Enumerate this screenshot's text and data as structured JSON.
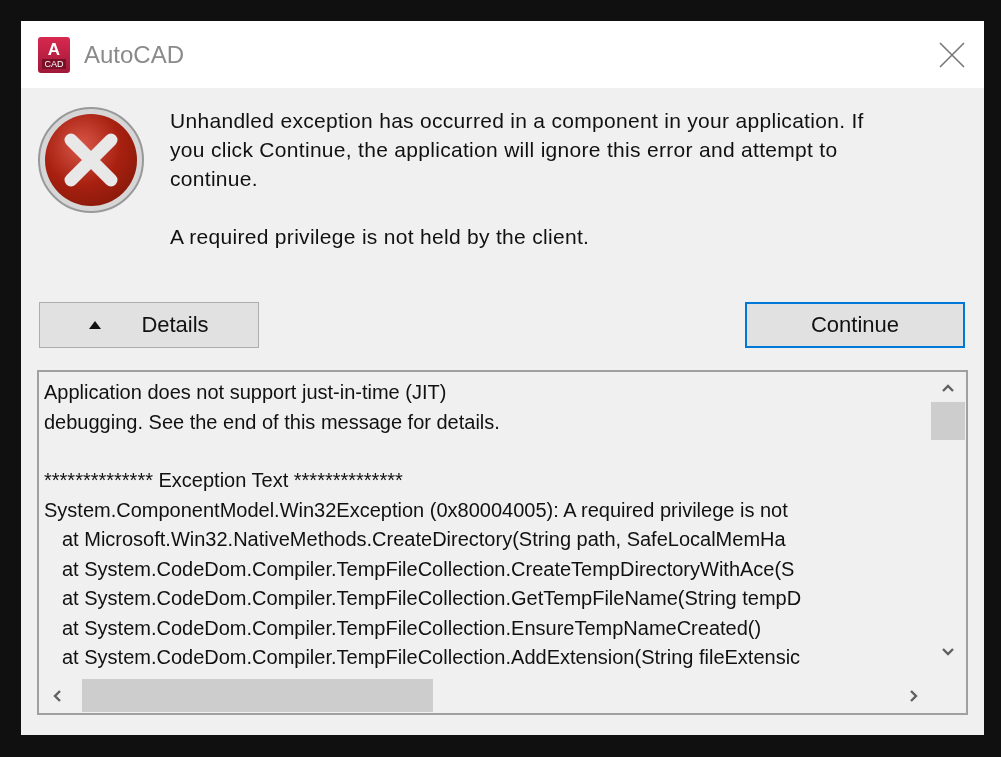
{
  "window": {
    "title": "AutoCAD",
    "logo_letter": "A",
    "logo_caption": "CAD"
  },
  "message": {
    "paragraphs": [
      "Unhandled exception has occurred in a component in your application. If you click Continue, the application will ignore this error and attempt to continue.",
      "A required privilege is not held by the client."
    ]
  },
  "buttons": [
    {
      "kind": "toggle",
      "label": "Details",
      "expanded": true,
      "focused": false
    },
    {
      "kind": "plain",
      "label": "Continue",
      "focused": true
    }
  ],
  "details": {
    "lines": [
      {
        "text": "Application does not support just-in-time (JIT)",
        "indented": false,
        "gap_before": false
      },
      {
        "text": "debugging. See the end of this message for details.",
        "indented": false,
        "gap_before": false
      },
      {
        "text": "************** Exception Text **************",
        "indented": false,
        "gap_before": true
      },
      {
        "text": "System.ComponentModel.Win32Exception (0x80004005): A required privilege is not",
        "indented": false,
        "gap_before": false
      },
      {
        "text": "at Microsoft.Win32.NativeMethods.CreateDirectory(String path, SafeLocalMemHa",
        "indented": true,
        "gap_before": false
      },
      {
        "text": "at System.CodeDom.Compiler.TempFileCollection.CreateTempDirectoryWithAce(S",
        "indented": true,
        "gap_before": false
      },
      {
        "text": "at System.CodeDom.Compiler.TempFileCollection.GetTempFileName(String tempD",
        "indented": true,
        "gap_before": false
      },
      {
        "text": "at System.CodeDom.Compiler.TempFileCollection.EnsureTempNameCreated()",
        "indented": true,
        "gap_before": false
      },
      {
        "text": "at System.CodeDom.Compiler.TempFileCollection.AddExtension(String fileExtensic",
        "indented": true,
        "gap_before": false
      }
    ]
  }
}
